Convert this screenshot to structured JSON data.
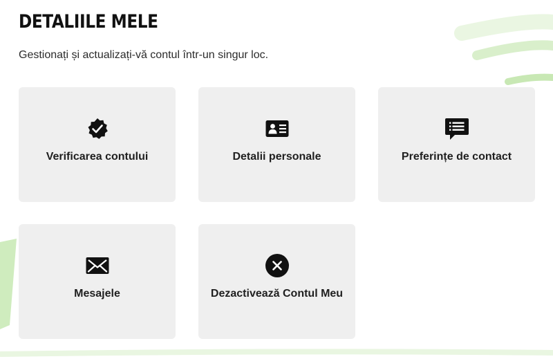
{
  "header": {
    "title": "DETALIILE MELE",
    "subtitle": "Gestionați și actualizați-vă contul într-un singur loc."
  },
  "cards": [
    {
      "label": "Verificarea contului",
      "icon": "verified-badge-icon"
    },
    {
      "label": "Detalii personale",
      "icon": "id-card-icon"
    },
    {
      "label": "Preferințe de contact",
      "icon": "chat-bubble-icon"
    },
    {
      "label": "Mesajele",
      "icon": "envelope-icon"
    },
    {
      "label": "Dezactivează Contul Meu",
      "icon": "close-circle-icon"
    }
  ],
  "colors": {
    "background": "#ffffff",
    "card_background": "#efefef",
    "icon": "#111111",
    "decoration_green": "#bfe6a8"
  }
}
